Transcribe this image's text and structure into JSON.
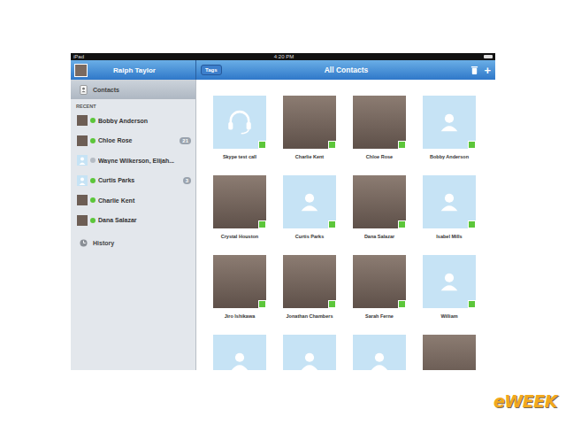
{
  "status_bar": {
    "carrier": "iPad",
    "time": "4:20 PM"
  },
  "header": {
    "user": "Ralph Taylor",
    "tags_button": "Tags",
    "title": "All Contacts",
    "add_button": "+"
  },
  "sidebar": {
    "contacts": {
      "label": "Contacts",
      "selected": true
    },
    "section": "RECENT",
    "recent": [
      {
        "name": "Bobby Anderson",
        "online": true,
        "kind": "photo",
        "badge": null
      },
      {
        "name": "Chloe Rose",
        "online": true,
        "kind": "photo",
        "badge": "21"
      },
      {
        "name": "Wayne Wilkerson, Elijah...",
        "online": false,
        "kind": "placeholder",
        "badge": null
      },
      {
        "name": "Curtis Parks",
        "online": true,
        "kind": "placeholder",
        "badge": "3"
      },
      {
        "name": "Charlie Kent",
        "online": true,
        "kind": "photo",
        "badge": null
      },
      {
        "name": "Dana Salazar",
        "online": true,
        "kind": "photo",
        "badge": null
      }
    ],
    "history": "History"
  },
  "contacts": [
    {
      "name": "Skype test call",
      "kind": "headset",
      "online": true
    },
    {
      "name": "Charlie Kent",
      "kind": "photo",
      "online": true
    },
    {
      "name": "Chloe Rose",
      "kind": "photo",
      "online": true
    },
    {
      "name": "Bobby Anderson",
      "kind": "placeholder",
      "online": true
    },
    {
      "name": "Crystal Houston",
      "kind": "photo",
      "online": true
    },
    {
      "name": "Curtis Parks",
      "kind": "placeholder",
      "online": true
    },
    {
      "name": "Dana Salazar",
      "kind": "photo",
      "online": true
    },
    {
      "name": "Isabel Mills",
      "kind": "placeholder",
      "online": true
    },
    {
      "name": "Jiro Ishikawa",
      "kind": "photo",
      "online": true
    },
    {
      "name": "Jonathan Chambers",
      "kind": "photo",
      "online": true
    },
    {
      "name": "Sarah Ferne",
      "kind": "photo",
      "online": true
    },
    {
      "name": "William",
      "kind": "placeholder",
      "online": true
    },
    {
      "name": null,
      "kind": "placeholder",
      "online": false
    },
    {
      "name": null,
      "kind": "placeholder",
      "online": false
    },
    {
      "name": null,
      "kind": "placeholder",
      "online": false
    },
    {
      "name": null,
      "kind": "photo",
      "online": false
    }
  ],
  "logo": "eWEEK"
}
